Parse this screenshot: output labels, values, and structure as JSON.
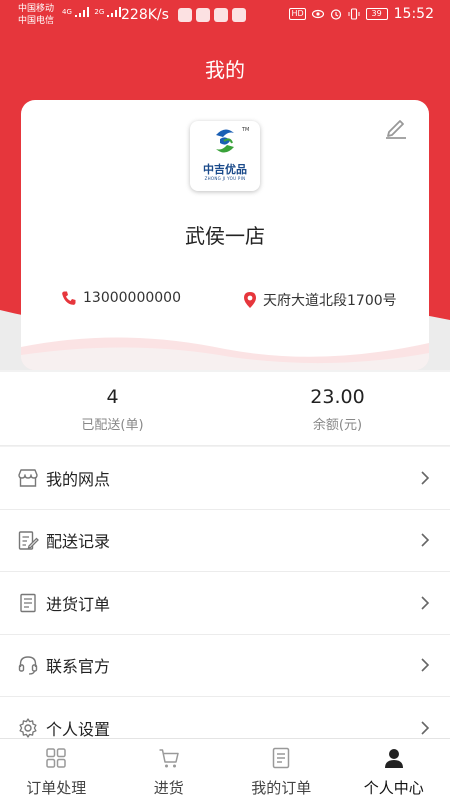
{
  "status_bar": {
    "carrier_1": "中国移动",
    "carrier_2": "中国电信",
    "network_1": "4G",
    "network_2": "2G",
    "speed": "228K/s",
    "hd": "HD",
    "battery": "39",
    "time": "15:52"
  },
  "header": {
    "title": "我的"
  },
  "profile": {
    "logo_name": "中吉优品",
    "logo_subtitle": "ZHONG JI YOU PIN",
    "logo_tm": "TM",
    "store_name": "武侯一店",
    "phone": "13000000000",
    "address": "天府大道北段1700号"
  },
  "stats": [
    {
      "value": "4",
      "label": "已配送(单)"
    },
    {
      "value": "23.00",
      "label": "余额(元)"
    }
  ],
  "menu": [
    {
      "label": "我的网点",
      "icon": "store-icon"
    },
    {
      "label": "配送记录",
      "icon": "edit-record-icon"
    },
    {
      "label": "进货订单",
      "icon": "document-icon"
    },
    {
      "label": "联系官方",
      "icon": "headset-icon"
    },
    {
      "label": "个人设置",
      "icon": "gear-icon"
    }
  ],
  "bottom_nav": [
    {
      "label": "订单处理",
      "icon": "grid-icon",
      "active": false
    },
    {
      "label": "进货",
      "icon": "cart-icon",
      "active": false
    },
    {
      "label": "我的订单",
      "icon": "document-icon",
      "active": false
    },
    {
      "label": "个人中心",
      "icon": "person-icon",
      "active": true
    }
  ],
  "colors": {
    "brand_red": "#e6363c",
    "icon_gray": "#777777"
  }
}
